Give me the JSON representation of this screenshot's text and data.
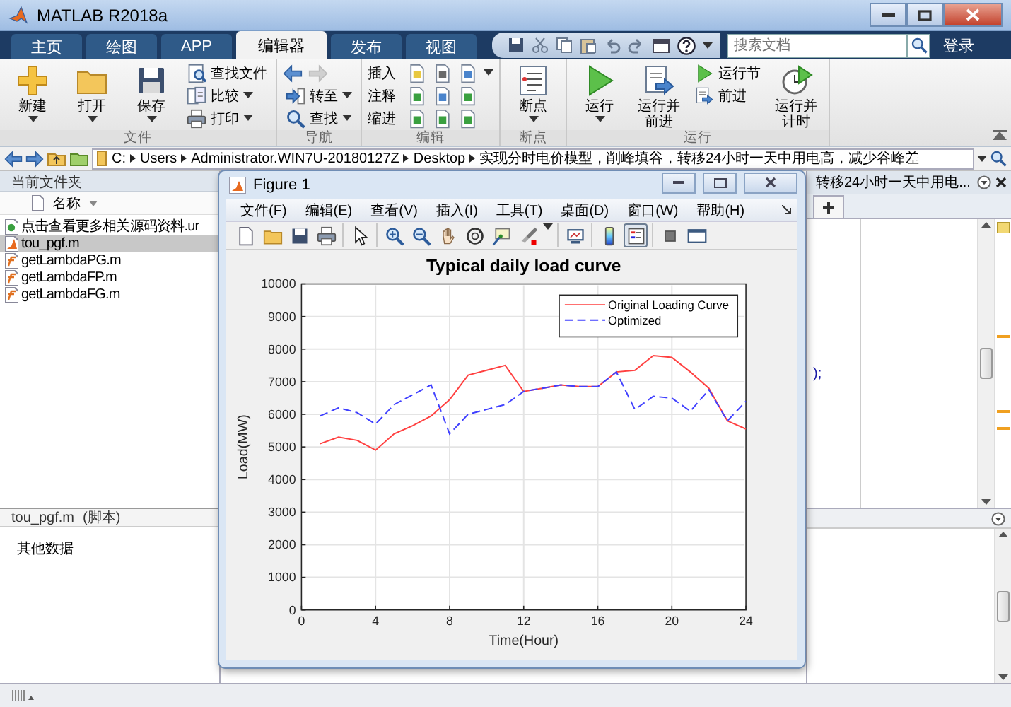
{
  "window": {
    "title": "MATLAB R2018a"
  },
  "tabs": [
    {
      "label": "主页",
      "selected": false
    },
    {
      "label": "绘图",
      "selected": false
    },
    {
      "label": "APP",
      "selected": false
    },
    {
      "label": "编辑器",
      "selected": true
    },
    {
      "label": "发布",
      "selected": false
    },
    {
      "label": "视图",
      "selected": false
    }
  ],
  "search": {
    "placeholder": "搜索文档"
  },
  "sign_in": "登录",
  "ribbon": [
    {
      "label": "文件",
      "columns": [
        [
          {
            "kind": "large",
            "label": "新建",
            "dropdown": true
          }
        ],
        [
          {
            "kind": "large",
            "label": "打开",
            "dropdown": true
          }
        ],
        [
          {
            "kind": "large",
            "label": "保存",
            "dropdown": true
          }
        ],
        [
          {
            "kind": "small",
            "label": "查找文件",
            "dropdown": false
          },
          {
            "kind": "small",
            "label": "比较",
            "dropdown": true
          },
          {
            "kind": "small",
            "label": "打印",
            "dropdown": true
          }
        ]
      ]
    },
    {
      "label": "导航",
      "columns": [
        [
          {
            "kind": "history",
            "forward_disabled": true
          },
          {
            "kind": "small",
            "label": "转至",
            "dropdown": true
          },
          {
            "kind": "small",
            "label": "查找",
            "dropdown": true
          }
        ]
      ]
    },
    {
      "label": "编辑",
      "columns": [
        [
          {
            "kind": "tools",
            "label": "插入",
            "dropdown": true
          },
          {
            "kind": "tools",
            "label": "注释",
            "dropdown": false
          },
          {
            "kind": "tools",
            "label": "缩进",
            "dropdown": false
          }
        ]
      ]
    },
    {
      "label": "断点",
      "columns": [
        [
          {
            "kind": "large",
            "label": "断点",
            "dropdown": true
          }
        ]
      ]
    },
    {
      "label": "运行",
      "columns": [
        [
          {
            "kind": "large",
            "label": "运行",
            "dropdown": true
          }
        ],
        [
          {
            "kind": "large",
            "label": "运行并前进",
            "dropdown": false
          }
        ],
        [
          {
            "kind": "small",
            "label": "运行节",
            "dropdown": false
          },
          {
            "kind": "small",
            "label": "前进",
            "dropdown": false
          }
        ],
        [
          {
            "kind": "large",
            "label": "运行并计时",
            "dropdown": false
          }
        ]
      ]
    }
  ],
  "address": {
    "crumbs": [
      "C:",
      "Users",
      "Administrator.WIN7U-20180127Z",
      "Desktop",
      "实现分时电价模型，削峰填谷，转移24小时一天中用电高，减少谷峰差"
    ]
  },
  "current_folder": {
    "title": "当前文件夹",
    "column": "名称",
    "files": [
      {
        "name": "点击查看更多相关源码资料.ur",
        "kind": "url",
        "selected": false
      },
      {
        "name": "tou_pgf.m",
        "kind": "script",
        "selected": true
      },
      {
        "name": "getLambdaPG.m",
        "kind": "function",
        "selected": false
      },
      {
        "name": "getLambdaFP.m",
        "kind": "function",
        "selected": false
      },
      {
        "name": "getLambdaFG.m",
        "kind": "function",
        "selected": false
      }
    ]
  },
  "details": {
    "file": "tou_pgf.m",
    "type": "(脚本)",
    "text": "其他数据"
  },
  "editor": {
    "document": "转移24小时一天中用电...",
    "code_fragment": ");"
  },
  "figure": {
    "title": "Figure 1",
    "menu": [
      "文件(F)",
      "编辑(E)",
      "查看(V)",
      "插入(I)",
      "工具(T)",
      "桌面(D)",
      "窗口(W)",
      "帮助(H)"
    ],
    "toolbar": [
      [
        {
          "kind": "new",
          "pressed": false
        },
        {
          "kind": "open",
          "pressed": false
        },
        {
          "kind": "save",
          "pressed": false
        },
        {
          "kind": "print",
          "pressed": false
        }
      ],
      [
        {
          "kind": "pointer",
          "pressed": false
        }
      ],
      [
        {
          "kind": "zoom-in",
          "pressed": false
        },
        {
          "kind": "zoom-out",
          "pressed": false
        },
        {
          "kind": "pan",
          "pressed": false
        },
        {
          "kind": "rotate",
          "pressed": false
        },
        {
          "kind": "data-cursor",
          "pressed": false
        },
        {
          "kind": "brush",
          "pressed": false
        }
      ],
      [
        {
          "kind": "link",
          "pressed": false
        }
      ],
      [
        {
          "kind": "colorbar",
          "pressed": false
        },
        {
          "kind": "legend",
          "pressed": true
        }
      ],
      [
        {
          "kind": "hide",
          "pressed": false
        },
        {
          "kind": "dock",
          "pressed": false
        }
      ]
    ],
    "chart_data": {
      "type": "line",
      "title": "Typical daily load curve",
      "xlabel": "Time(Hour)",
      "ylabel": "Load(MW)",
      "x": [
        1,
        2,
        3,
        4,
        5,
        6,
        7,
        8,
        9,
        10,
        11,
        12,
        13,
        14,
        15,
        16,
        17,
        18,
        19,
        20,
        21,
        22,
        23,
        24
      ],
      "series": [
        {
          "name": "Original Loading Curve",
          "color": "#ff4040",
          "line_style": "solid",
          "values": [
            5100,
            5300,
            5200,
            4900,
            5400,
            5650,
            5950,
            6450,
            7200,
            7350,
            7500,
            6700,
            6800,
            6900,
            6850,
            6850,
            7300,
            7350,
            7800,
            7750,
            7300,
            6800,
            5800,
            5550
          ]
        },
        {
          "name": "Optimized",
          "color": "#4040ff",
          "line_style": "dashed",
          "values": [
            5950,
            6200,
            6050,
            5700,
            6300,
            6600,
            6900,
            5400,
            6000,
            6150,
            6300,
            6700,
            6800,
            6900,
            6850,
            6850,
            7300,
            6150,
            6550,
            6500,
            6100,
            6750,
            5800,
            6400
          ]
        }
      ],
      "grid": true,
      "legend": true,
      "xlim": [
        0,
        24
      ],
      "ylim": [
        0,
        10000
      ],
      "xticks": [
        0,
        4,
        8,
        12,
        16,
        20,
        24
      ],
      "yticks": [
        0,
        1000,
        2000,
        3000,
        4000,
        5000,
        6000,
        7000,
        8000,
        9000,
        10000
      ]
    }
  }
}
